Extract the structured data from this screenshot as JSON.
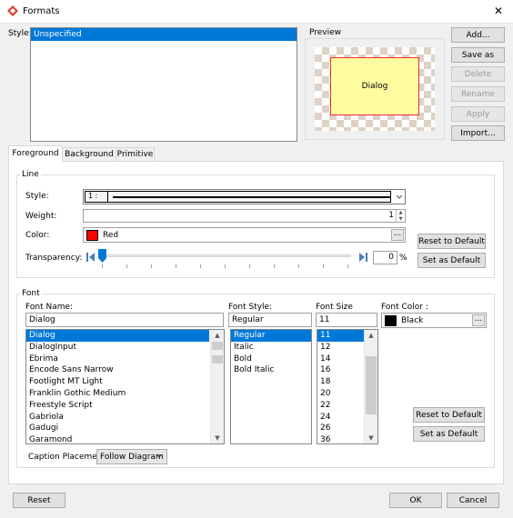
{
  "window": {
    "title": "Formats",
    "close_glyph": "✕"
  },
  "style": {
    "label": "Style:",
    "items": [
      "Unspecified"
    ]
  },
  "preview": {
    "label": "Preview",
    "box_text": "Dialog"
  },
  "side_buttons": {
    "add": "Add...",
    "save_as": "Save as",
    "delete": "Delete",
    "rename": "Rename",
    "apply": "Apply",
    "import": "Import..."
  },
  "tabs": [
    "Foreground",
    "Background",
    "Primitive"
  ],
  "line": {
    "group_label": "Line",
    "style_label": "Style:",
    "style_value": "1 :",
    "weight_label": "Weight:",
    "weight_value": "1",
    "color_label": "Color:",
    "color_name": "Red",
    "color_hex": "#ff0000",
    "color_more": "...",
    "transparency_label": "Transparency:",
    "transparency_value": "0",
    "transparency_unit": "%",
    "reset_label": "Reset to Default",
    "set_default_label": "Set as Default"
  },
  "font": {
    "group_label": "Font",
    "name_label": "Font Name:",
    "name_value": "Dialog",
    "names": [
      "Dialog",
      "DialogInput",
      "Ebrima",
      "Encode Sans Narrow",
      "Footlight MT Light",
      "Franklin Gothic Medium",
      "Freestyle Script",
      "Gabriola",
      "Gadugi",
      "Garamond"
    ],
    "style_label": "Font Style:",
    "style_value": "Regular",
    "styles": [
      "Regular",
      "Italic",
      "Bold",
      "Bold Italic"
    ],
    "size_label": "Font Size",
    "size_value": "11",
    "sizes": [
      "11",
      "12",
      "14",
      "16",
      "18",
      "20",
      "22",
      "24",
      "26",
      "36"
    ],
    "color_label": "Font Color :",
    "color_name": "Black",
    "color_hex": "#000000",
    "color_more": "...",
    "reset_label": "Reset to Default",
    "set_default_label": "Set as Default",
    "caption_label": "Caption Placement",
    "caption_value": "Follow Diagram"
  },
  "footer": {
    "reset": "Reset",
    "ok": "OK",
    "cancel": "Cancel"
  }
}
